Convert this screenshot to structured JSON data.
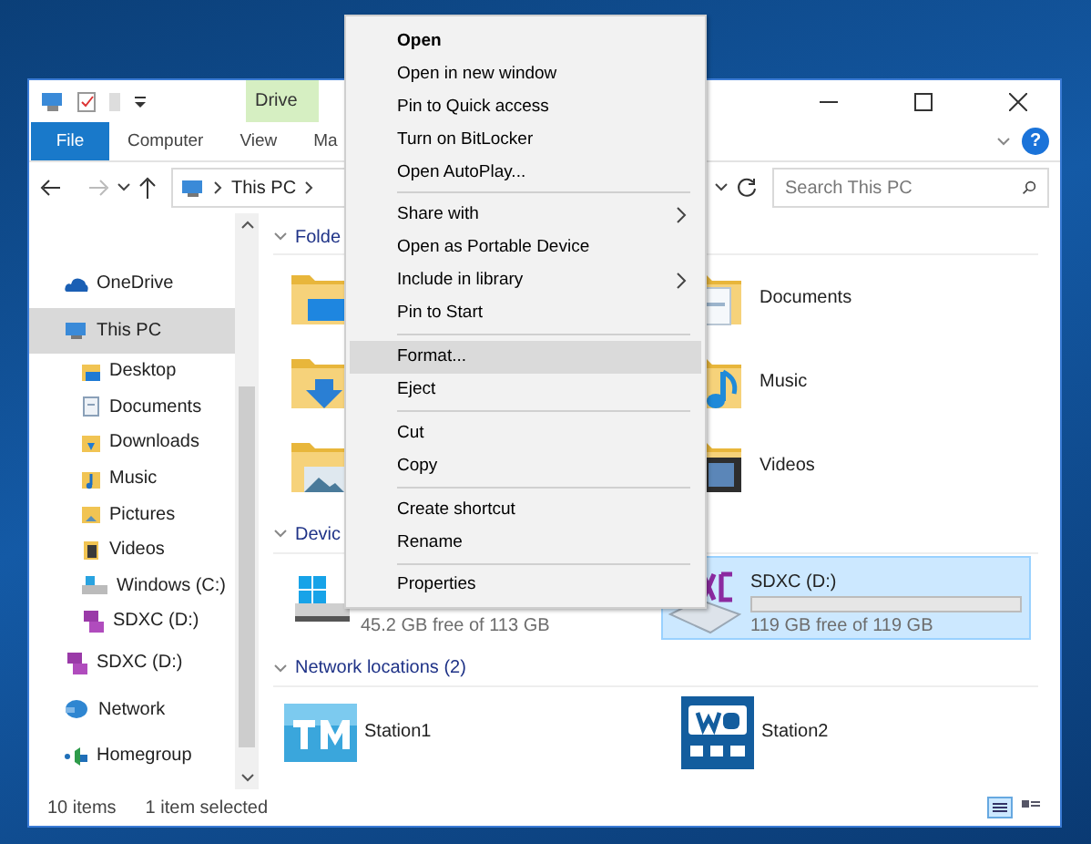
{
  "window": {
    "context_tab": "Drive",
    "help": "?"
  },
  "ribbon": {
    "file": "File",
    "tabs": [
      {
        "label": "Computer",
        "selected": false
      },
      {
        "label": "View",
        "selected": false
      },
      {
        "label": "Ma",
        "selected": false
      }
    ]
  },
  "address": {
    "crumbs": [
      "This PC"
    ],
    "search": {
      "placeholder": "Search This PC"
    }
  },
  "nav": {
    "items": [
      {
        "label": "OneDrive",
        "kind": "cloud",
        "selected": false
      },
      {
        "label": "This PC",
        "kind": "pc",
        "selected": true,
        "children": [
          {
            "label": "Desktop",
            "kind": "desktop",
            "selected": false
          },
          {
            "label": "Documents",
            "kind": "documents",
            "selected": false
          },
          {
            "label": "Downloads",
            "kind": "downloads",
            "selected": false
          },
          {
            "label": "Music",
            "kind": "music",
            "selected": false
          },
          {
            "label": "Pictures",
            "kind": "pictures",
            "selected": false
          },
          {
            "label": "Videos",
            "kind": "videos",
            "selected": false
          },
          {
            "label": "Windows (C:)",
            "kind": "drive",
            "selected": false
          },
          {
            "label": "SDXC (D:)",
            "kind": "sd",
            "selected": false
          }
        ]
      },
      {
        "label": "SDXC (D:)",
        "kind": "sd",
        "selected": false
      },
      {
        "label": "Network",
        "kind": "network",
        "selected": false
      },
      {
        "label": "Homegroup",
        "kind": "homegroup",
        "selected": false
      }
    ]
  },
  "content": {
    "folders": {
      "heading": "Folde",
      "items": [
        {
          "kind": "desktop"
        },
        {
          "kind": "documents",
          "label": "Documents"
        },
        {
          "kind": "downloads"
        },
        {
          "kind": "music",
          "label": "Music"
        },
        {
          "kind": "pictures"
        },
        {
          "kind": "videos",
          "label": "Videos"
        }
      ]
    },
    "devices": {
      "heading": "Devic",
      "items": [
        {
          "kind": "drive",
          "free": "45.2 GB free of 113 GB",
          "selected": false
        },
        {
          "kind": "sd",
          "name": "SDXC (D:)",
          "level": 0,
          "free": "119 GB free of 119 GB",
          "selected": true
        }
      ]
    },
    "network": {
      "heading": "Network locations (2)",
      "items": [
        {
          "kind": "tm",
          "label": "Station1"
        },
        {
          "kind": "wd",
          "label": "Station2"
        }
      ]
    }
  },
  "status_bar": {
    "count": "10 items",
    "selection": "1 item selected"
  },
  "context_menu": {
    "groups": [
      [
        {
          "label": "Open",
          "bold": true,
          "submenu": false,
          "selected": false
        },
        {
          "label": "Open in new window",
          "bold": false,
          "submenu": false,
          "selected": false
        },
        {
          "label": "Pin to Quick access",
          "bold": false,
          "submenu": false,
          "selected": false
        },
        {
          "label": "Turn on BitLocker",
          "bold": false,
          "submenu": false,
          "selected": false
        },
        {
          "label": "Open AutoPlay...",
          "bold": false,
          "submenu": false,
          "selected": false
        }
      ],
      [
        {
          "label": "Share with",
          "bold": false,
          "submenu": true,
          "selected": false
        },
        {
          "label": "Open as Portable Device",
          "bold": false,
          "submenu": false,
          "selected": false
        },
        {
          "label": "Include in library",
          "bold": false,
          "submenu": true,
          "selected": false
        },
        {
          "label": "Pin to Start",
          "bold": false,
          "submenu": false,
          "selected": false
        }
      ],
      [
        {
          "label": "Format...",
          "bold": false,
          "submenu": false,
          "selected": true
        },
        {
          "label": "Eject",
          "bold": false,
          "submenu": false,
          "selected": false
        }
      ],
      [
        {
          "label": "Cut",
          "bold": false,
          "submenu": false,
          "selected": false
        },
        {
          "label": "Copy",
          "bold": false,
          "submenu": false,
          "selected": false
        }
      ],
      [
        {
          "label": "Create shortcut",
          "bold": false,
          "submenu": false,
          "selected": false
        },
        {
          "label": "Rename",
          "bold": false,
          "submenu": false,
          "selected": false
        }
      ],
      [
        {
          "label": "Properties",
          "bold": false,
          "submenu": false,
          "selected": false
        }
      ]
    ]
  }
}
